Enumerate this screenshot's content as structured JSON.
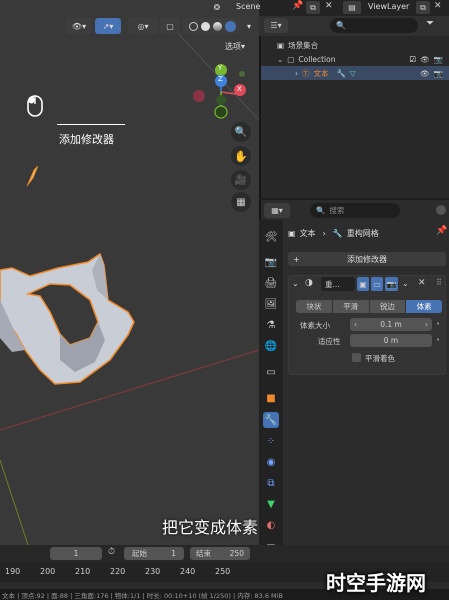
{
  "topbar": {
    "scene_label": "Scene",
    "viewlayer_label": "ViewLayer"
  },
  "viewport": {
    "options_label": "选项",
    "axis_labels": {
      "z": "Z",
      "y": "Y",
      "x": "X"
    },
    "hint_text": "添加修改器",
    "subtitle": "把它变成体素"
  },
  "outliner": {
    "search_placeholder": "",
    "items": [
      {
        "label": "场景集合"
      },
      {
        "label": "Collection"
      },
      {
        "label": "文本"
      }
    ]
  },
  "properties": {
    "search_placeholder": "搜索",
    "breadcrumb": {
      "object": "文本",
      "modifier": "重构网格"
    },
    "add_modifier_label": "添加修改器",
    "modifier": {
      "name": "重...",
      "modes": [
        "块状",
        "平滑",
        "锐边",
        "体素"
      ],
      "active_mode": "体素",
      "voxel_size_label": "体素大小",
      "voxel_size_value": "0.1 m",
      "adaptivity_label": "适应性",
      "adaptivity_value": "0 m",
      "smooth_shading_label": "平滑着色"
    }
  },
  "timeline": {
    "current_frame": "1",
    "start_label": "起始",
    "start_value": "1",
    "end_label": "结束",
    "end_value": "250",
    "ruler_ticks": [
      "190",
      "200",
      "210",
      "220",
      "230",
      "240",
      "250"
    ]
  },
  "statusbar": {
    "left_text": "文本 | 顶点:92 | 面:88 | 三角面:176 | 物体:1/1 | 时长: 00:10+10 (帧 1/250) | 内存: 83.6 MiB"
  },
  "watermark": {
    "text": "时空手游网"
  },
  "colors": {
    "accent_blue": "#4772b3",
    "axis_x": "#e04b5a",
    "axis_y": "#77b82f",
    "axis_z": "#3f82e0",
    "selection_orange": "#f08a2a"
  }
}
